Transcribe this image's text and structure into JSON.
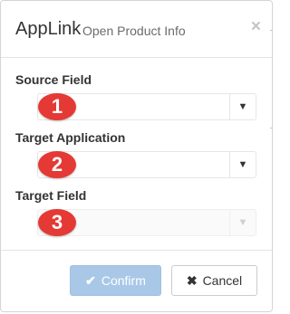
{
  "dialog": {
    "title": "AppLink",
    "subtitle": "Open Product Info",
    "close_icon": "×"
  },
  "fields": [
    {
      "label": "Source Field",
      "badge": "1",
      "value": "",
      "disabled": false
    },
    {
      "label": "Target Application",
      "badge": "2",
      "value": "",
      "disabled": false
    },
    {
      "label": "Target Field",
      "badge": "3",
      "value": "",
      "disabled": true
    }
  ],
  "icons": {
    "caret": "▼",
    "check": "✔",
    "cross": "✖"
  },
  "buttons": {
    "confirm_label": "Confirm",
    "cancel_label": "Cancel"
  },
  "colors": {
    "badge": "#e53935",
    "confirm_bg": "#a9c8e8"
  }
}
